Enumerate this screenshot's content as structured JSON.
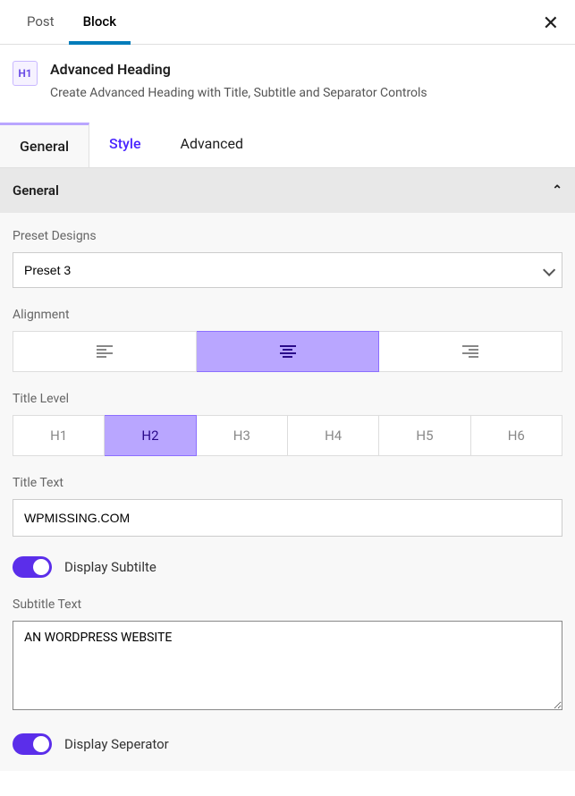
{
  "topTabs": {
    "post": "Post",
    "block": "Block"
  },
  "blockHeader": {
    "iconText": "H1",
    "title": "Advanced Heading",
    "desc": "Create Advanced Heading with Title, Subtitle and Separator Controls"
  },
  "subTabs": {
    "general": "General",
    "style": "Style",
    "advanced": "Advanced"
  },
  "section": {
    "title": "General"
  },
  "preset": {
    "label": "Preset Designs",
    "value": "Preset 3"
  },
  "alignment": {
    "label": "Alignment",
    "options": [
      "left",
      "center",
      "right"
    ],
    "active": "center"
  },
  "titleLevel": {
    "label": "Title Level",
    "options": [
      "H1",
      "H2",
      "H3",
      "H4",
      "H5",
      "H6"
    ],
    "active": "H2"
  },
  "titleText": {
    "label": "Title Text",
    "value": "WPMISSING.COM"
  },
  "displaySubtitle": {
    "label": "Display Subtilte",
    "on": true
  },
  "subtitleText": {
    "label": "Subtitle Text",
    "value": "AN WORDPRESS WEBSITE"
  },
  "displaySeparator": {
    "label": "Display Seperator",
    "on": true
  }
}
